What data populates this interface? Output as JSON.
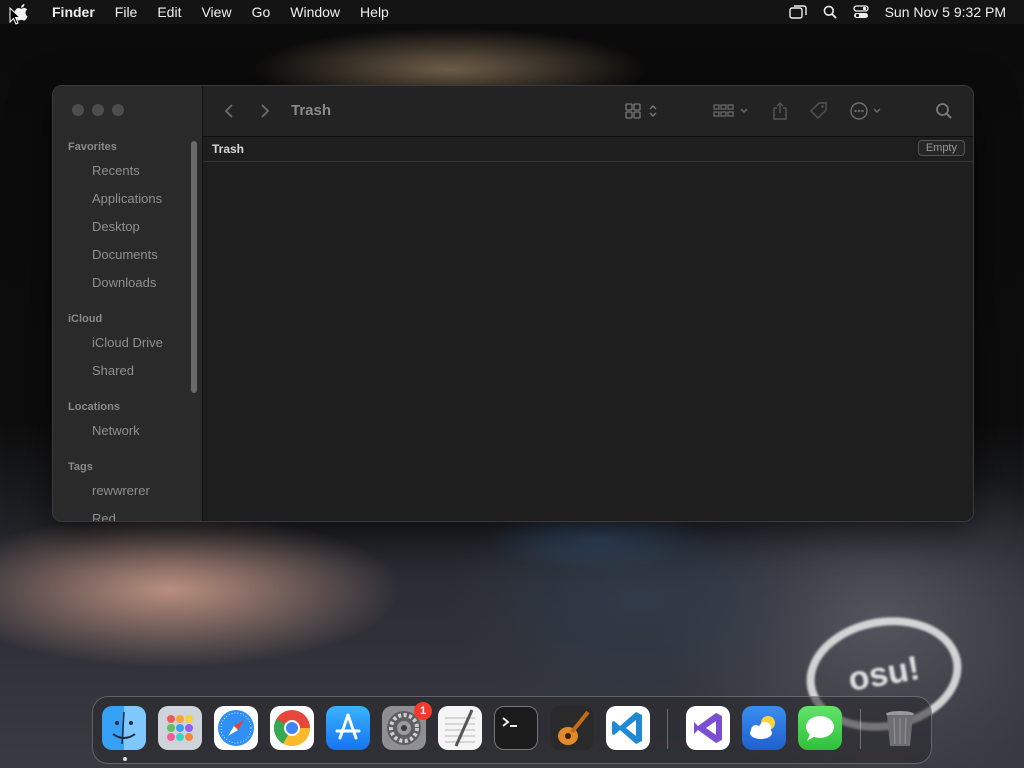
{
  "menubar": {
    "app_name": "Finder",
    "menus": [
      "File",
      "Edit",
      "View",
      "Go",
      "Window",
      "Help"
    ],
    "clock": "Sun Nov 5  9:32 PM",
    "status_icons": [
      "screen-mirroring-icon",
      "spotlight-search-icon",
      "control-center-icon"
    ]
  },
  "finder": {
    "title": "Trash",
    "sidebar": {
      "favorites_header": "Favorites",
      "favorites": [
        "Recents",
        "Applications",
        "Desktop",
        "Documents",
        "Downloads"
      ],
      "icloud_header": "iCloud",
      "icloud": [
        "iCloud Drive",
        "Shared"
      ],
      "locations_header": "Locations",
      "locations": [
        "Network"
      ],
      "tags_header": "Tags",
      "tags": [
        "rewwrerer",
        "Red"
      ]
    },
    "content": {
      "folder_label": "Trash",
      "empty_button": "Empty"
    }
  },
  "dock": {
    "apps": [
      "Finder",
      "Launchpad",
      "Safari",
      "Google Chrome",
      "App Store",
      "System Settings",
      "TextEdit",
      "Terminal",
      "GarageBand",
      "Visual Studio Code",
      "Visual Studio",
      "Weather",
      "Messages",
      "Trash"
    ],
    "system_settings_badge": "1"
  },
  "wallpaper": {
    "logo_text": "osu!"
  },
  "colors": {
    "menubar_bg": "#141414",
    "window_bg": "#1e1e1e",
    "sidebar_bg": "#2a2a2a",
    "badge_red": "#f23b2e"
  }
}
